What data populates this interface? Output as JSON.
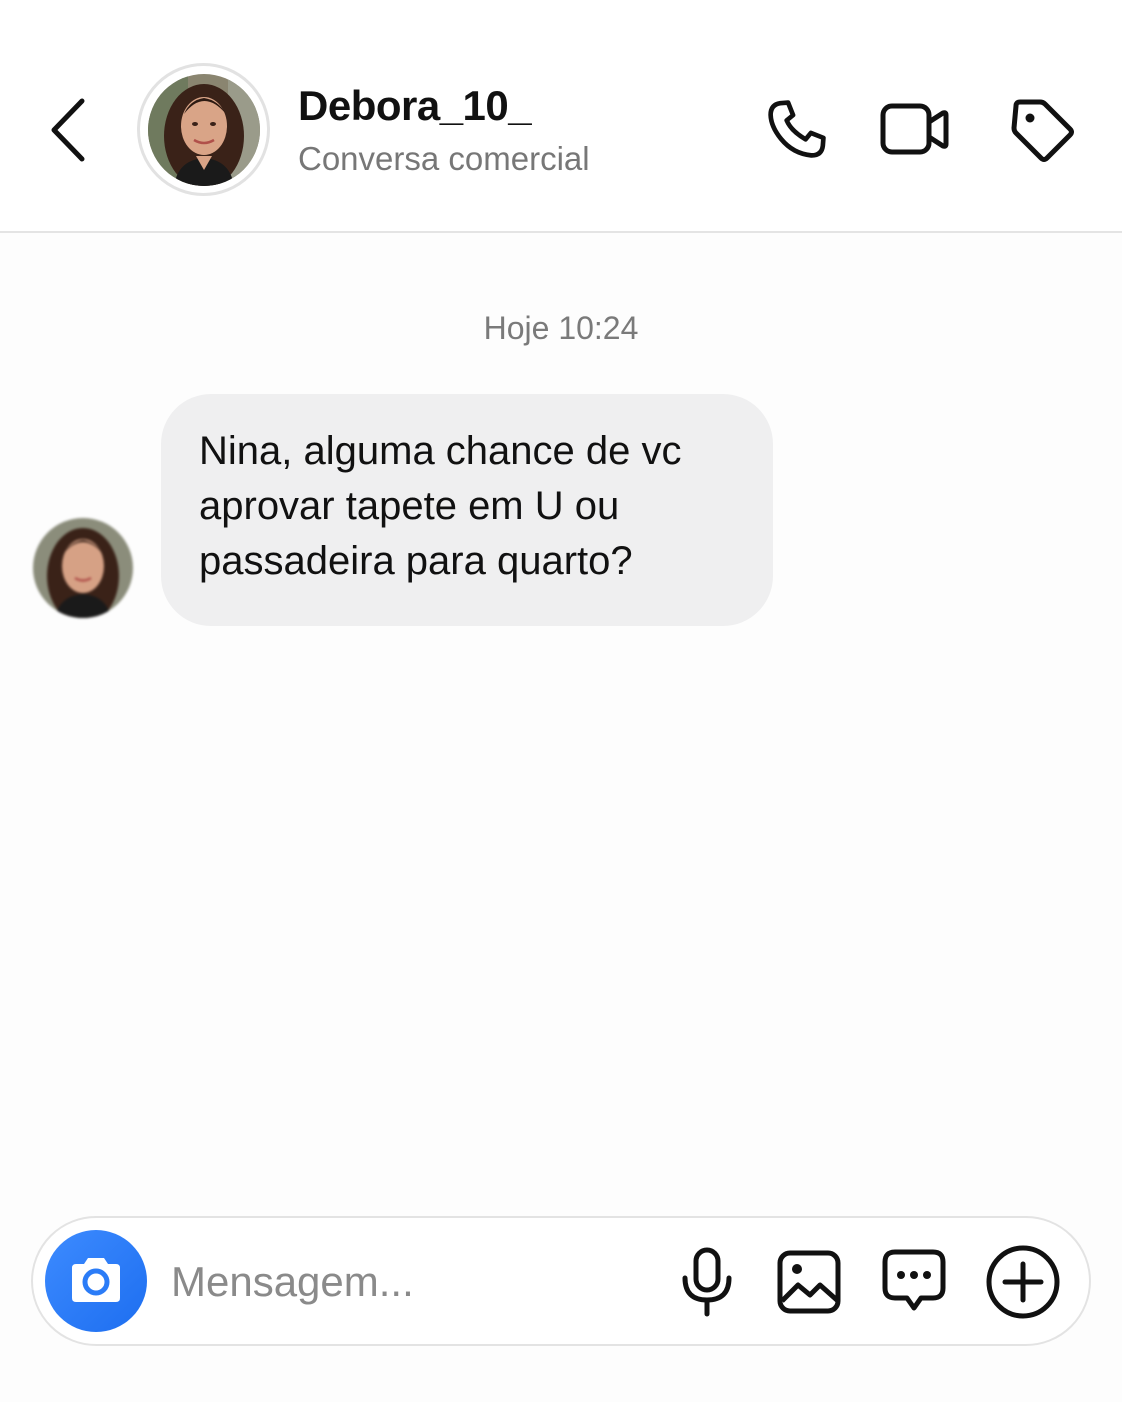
{
  "header": {
    "back_icon": "chevron-left-icon",
    "contact_name": "Debora_10_",
    "subtitle": "Conversa comercial",
    "actions": [
      "phone-icon",
      "video-camera-icon",
      "tag-icon"
    ]
  },
  "chat": {
    "timestamp": "Hoje 10:24",
    "messages": [
      {
        "sender": "incoming",
        "text": "Nina, alguma chance de vc\naprovar tapete em U ou\npassadeira para quarto?"
      }
    ]
  },
  "composer": {
    "placeholder": "Mensagem...",
    "camera_icon": "camera-icon",
    "tools": [
      "microphone-icon",
      "gallery-icon",
      "chat-bubble-icon",
      "plus-circle-icon"
    ]
  },
  "colors": {
    "accent": "#2b7cf7",
    "bubble_bg": "#efeff0",
    "muted_text": "#777777",
    "divider": "#e4e4e4"
  }
}
